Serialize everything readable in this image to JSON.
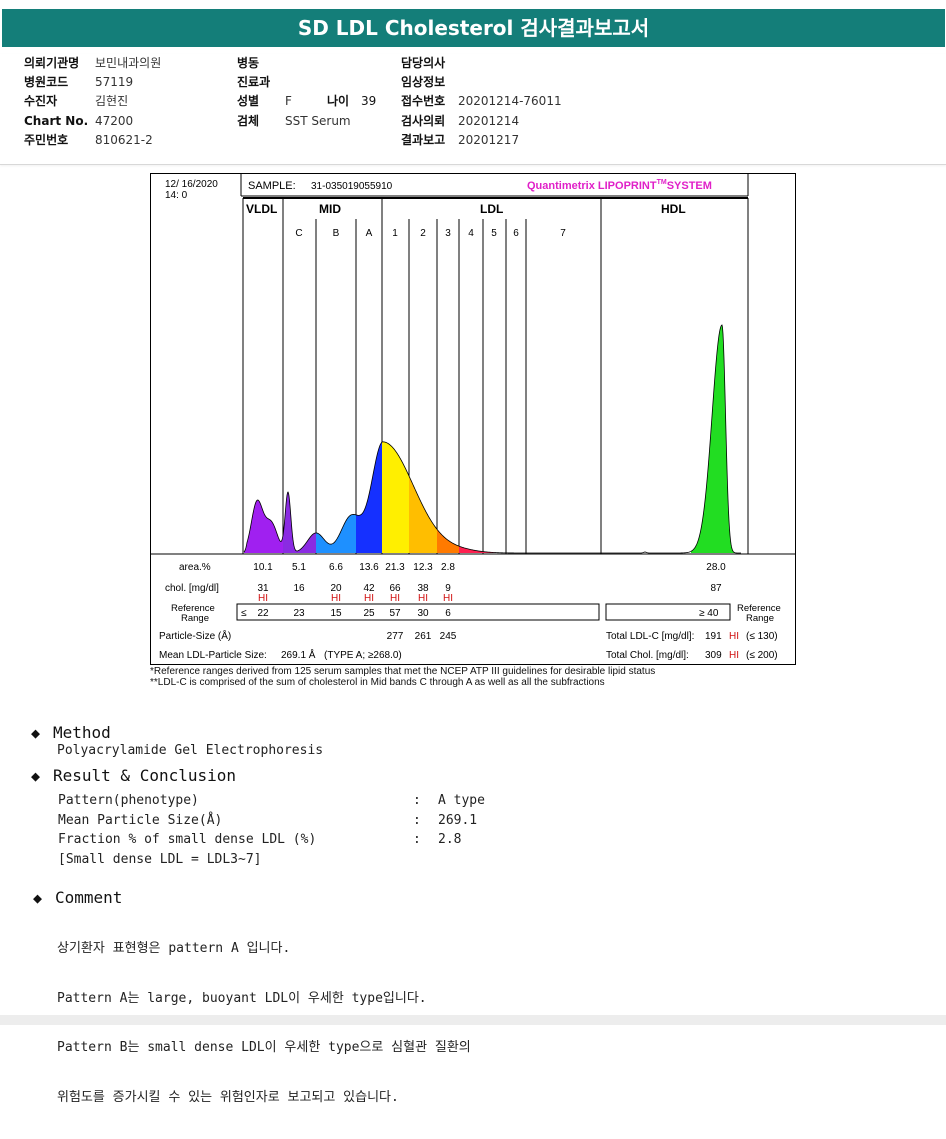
{
  "header": {
    "title": "SD LDL Cholesterol 검사결과보고서"
  },
  "info": {
    "col1": [
      {
        "k": "의뢰기관명",
        "v": "보민내과의원"
      },
      {
        "k": "병원코드",
        "v": "57119"
      },
      {
        "k": "수진자",
        "v": "김현진"
      },
      {
        "k": "Chart No.",
        "v": "47200"
      },
      {
        "k": "주민번호",
        "v": "810621-2"
      }
    ],
    "col2": [
      {
        "k": "병동",
        "v": ""
      },
      {
        "k": "진료과",
        "v": ""
      },
      {
        "k": "성별",
        "v": "F"
      },
      {
        "k": "검체",
        "v": "SST Serum"
      }
    ],
    "age": {
      "k": "나이",
      "v": "39"
    },
    "col3": [
      {
        "k": "담당의사",
        "v": ""
      },
      {
        "k": "임상정보",
        "v": ""
      },
      {
        "k": "접수번호",
        "v": "20201214-76011"
      },
      {
        "k": "검사의뢰",
        "v": "20201214"
      },
      {
        "k": "결과보고",
        "v": "20201217"
      }
    ]
  },
  "report": {
    "date": "12/ 16/2020",
    "time": "14: 0",
    "sample_label": "SAMPLE:",
    "sample_id": "31-035019055910",
    "brand": "Quantimetrix LIPOPRINT",
    "brand_tm": "TM",
    "brand_suffix": "SYSTEM",
    "groups": [
      "VLDL",
      "MID",
      "LDL",
      "HDL"
    ],
    "bands": [
      "C",
      "B",
      "A",
      "1",
      "2",
      "3",
      "4",
      "5",
      "6",
      "7"
    ],
    "row_labels": {
      "area": "area.%",
      "chol": "chol. [mg/dl]",
      "ref": "Reference\nRange",
      "particle": "Particle-Size (Å)",
      "mean": "Mean LDL-Particle Size:"
    },
    "area": [
      "10.1",
      "5.1",
      "6.6",
      "13.6",
      "21.3",
      "12.3",
      "2.8"
    ],
    "chol": [
      "31",
      "16",
      "20",
      "42",
      "66",
      "38",
      "9"
    ],
    "chol_flags": [
      "HI",
      "",
      "HI",
      "HI",
      "HI",
      "HI",
      "HI"
    ],
    "ref_prefix": "≤",
    "ref": [
      "22",
      "23",
      "15",
      "25",
      "57",
      "30",
      "6"
    ],
    "particle": [
      "277",
      "261",
      "245"
    ],
    "mean_value": "269.1 Å",
    "mean_type": "(TYPE A; ≥268.0)",
    "hdl_area": "28.0",
    "hdl_chol": "87",
    "hdl_ref": "≥ 40",
    "total_ldl_label": "Total LDL-C [mg/dl]:",
    "total_ldl_value": "191",
    "total_ldl_flag": "HI",
    "total_ldl_ref": "(≤ 130)",
    "total_chol_label": "Total Chol. [mg/dl]:",
    "total_chol_value": "309",
    "total_chol_flag": "HI",
    "total_chol_ref": "(≤ 200)",
    "footnote1": "*Reference ranges derived from 125 serum samples that met the NCEP ATP III guidelines for desirable lipid status",
    "footnote2": "**LDL-C is comprised of the sum of cholesterol in Mid bands C through A as well as all the subfractions"
  },
  "method": {
    "title": "Method",
    "text": "Polyacrylamide Gel Electrophoresis"
  },
  "result": {
    "title": "Result & Conclusion",
    "rows": [
      {
        "label": "Pattern(phenotype)",
        "sep": ":",
        "value": "A type"
      },
      {
        "label": "Mean Particle Size(Å)",
        "sep": ":",
        "value": "269.1"
      },
      {
        "label": "Fraction % of small dense LDL (%)",
        "sep": ":",
        "value": "2.8"
      }
    ],
    "note": "[Small dense LDL = LDL3~7]"
  },
  "comment": {
    "title": "Comment",
    "lines": [
      "상기환자 표현형은 pattern A 입니다.",
      "Pattern A는 large, buoyant LDL이 우세한 type입니다.",
      "Pattern B는 small dense LDL이 우세한 type으로 심혈관 질환의",
      "위험도를 증가시킬 수 있는 위험인자로 보고되고 있습니다."
    ]
  },
  "colors": {
    "header_bg": "#147e79",
    "brand": "#e020c8",
    "flag": "#d01010",
    "vldl": "#a020f0",
    "mid_c": "#8a2be2",
    "mid_b": "#1e90ff",
    "mid_a": "#1530ff",
    "ldl1": "#ffef00",
    "ldl2": "#ffbe00",
    "ldl3": "#ff7a00",
    "ldl4": "#ff2050",
    "hdl": "#22dd22"
  }
}
